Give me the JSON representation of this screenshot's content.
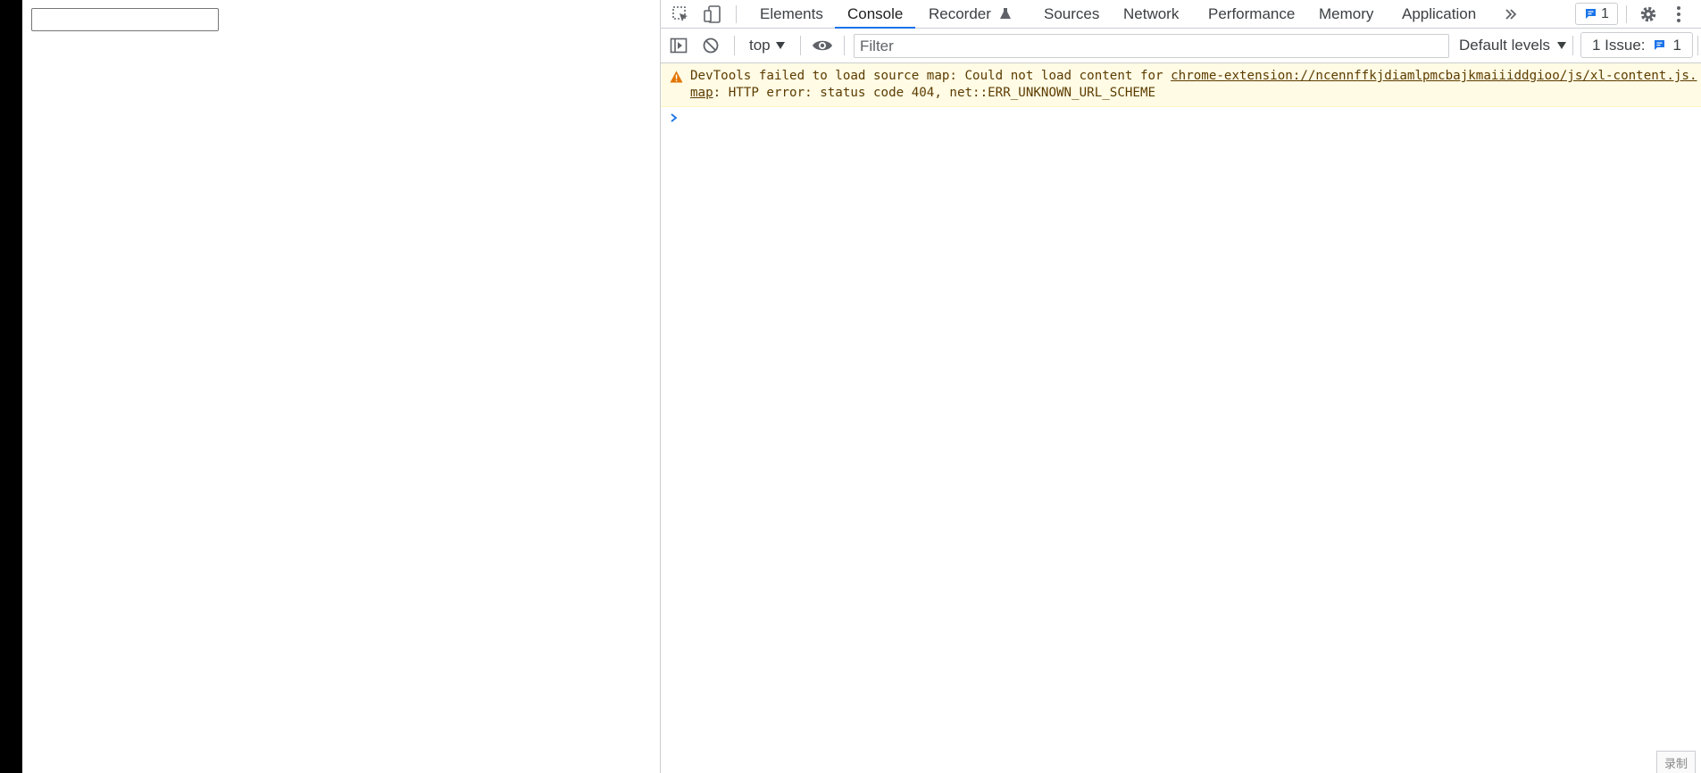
{
  "page": {
    "input_value": ""
  },
  "devtools": {
    "tabs": [
      {
        "label": "Elements"
      },
      {
        "label": "Console"
      },
      {
        "label": "Recorder"
      },
      {
        "label": "Sources"
      },
      {
        "label": "Network"
      },
      {
        "label": "Performance"
      },
      {
        "label": "Memory"
      },
      {
        "label": "Application"
      }
    ],
    "active_tab": "Console",
    "messages_badge_count": "1",
    "toolbar": {
      "context": "top",
      "filter_placeholder": "Filter",
      "levels": "Default levels",
      "issues_label": "1 Issue:",
      "issues_count": "1"
    },
    "console": {
      "warning_prefix": "DevTools failed to load source map: Could not load content for ",
      "warning_link": "chrome-extension://ncennffkjdiamlpmcbajkmaiiiddgioo/js/xl-content.js.map",
      "warning_suffix": ": HTTP error: status code 404, net::ERR_UNKNOWN_URL_SCHEME"
    },
    "corner_label": "录制"
  },
  "colors": {
    "accent": "#1a73e8",
    "warning_bg": "#fffbe5",
    "warning_text": "#5c3c00",
    "warning_icon": "#e37400"
  }
}
